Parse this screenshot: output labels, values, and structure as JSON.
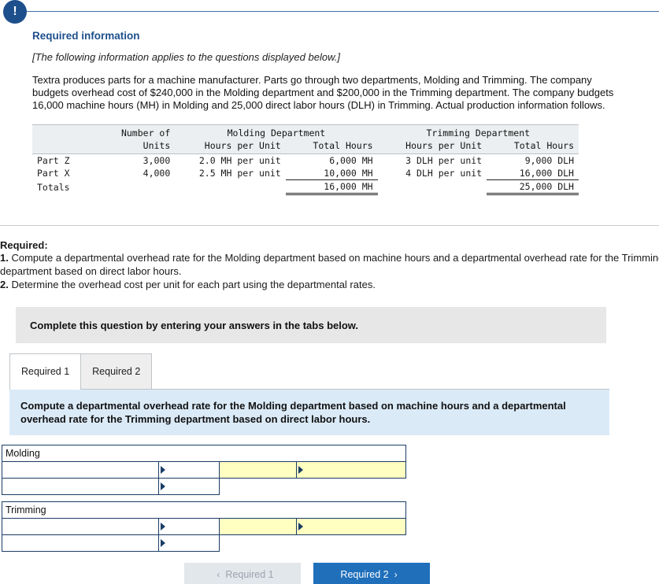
{
  "badge": {
    "glyph": "!"
  },
  "header": {
    "title": "Required information",
    "note": "[The following information applies to the questions displayed below.]",
    "paragraph": "Textra produces parts for a machine manufacturer. Parts go through two departments, Molding and Trimming. The company budgets overhead cost of $240,000 in the Molding department and $200,000 in the Trimming department. The company budgets 16,000 machine hours (MH) in Molding and 25,000 direct labor hours (DLH) in Trimming. Actual production information follows."
  },
  "data_table": {
    "group_headers": {
      "molding": "Molding Department",
      "trimming": "Trimming Department"
    },
    "sub_headers": {
      "blank": "",
      "units_line1": "Number of",
      "units_line2": "Units",
      "mold_per": "Hours per Unit",
      "mold_total": "Total Hours",
      "trim_per": "Hours per Unit",
      "trim_total": "Total Hours"
    },
    "rows": [
      {
        "label": "Part Z",
        "units": "3,000",
        "mold_per": "2.0 MH per unit",
        "mold_total": "6,000 MH",
        "trim_per": "3 DLH per unit",
        "trim_total": "9,000 DLH"
      },
      {
        "label": "Part X",
        "units": "4,000",
        "mold_per": "2.5 MH per unit",
        "mold_total": "10,000 MH",
        "trim_per": "4 DLH per unit",
        "trim_total": "16,000 DLH"
      },
      {
        "label": "Totals",
        "units": "",
        "mold_per": "",
        "mold_total": "16,000 MH",
        "trim_per": "",
        "trim_total": "25,000 DLH"
      }
    ]
  },
  "required": {
    "lead": "Required:",
    "item1_num": "1.",
    "item1_text": " Compute a departmental overhead rate for the Molding department based on machine hours and a departmental overhead rate for the Trimming department based on direct labor hours.",
    "item2_num": "2.",
    "item2_text": " Determine the overhead cost per unit for each part using the departmental rates."
  },
  "instruction_bar": {
    "text": "Complete this question by entering your answers in the tabs below."
  },
  "tabs": [
    {
      "label": "Required 1",
      "active": true
    },
    {
      "label": "Required 2",
      "active": false
    }
  ],
  "question_panel": {
    "text": "Compute a departmental overhead rate for the Molding department based on machine hours and a departmental overhead rate for the Trimming department based on direct labor hours."
  },
  "answer_grid": {
    "molding_label": "Molding",
    "trimming_label": "Trimming",
    "empty": ""
  },
  "nav": {
    "prev_label": "Required 1",
    "next_label": "Required 2",
    "prev_chevron": "‹",
    "next_chevron": "›"
  },
  "colors": {
    "accent_blue": "#1d4f8c",
    "panel_blue": "#dbeaf7",
    "next_button": "#1f6fbb",
    "input_yellow": "#ffffc2",
    "grid_border": "#1a3d66"
  }
}
